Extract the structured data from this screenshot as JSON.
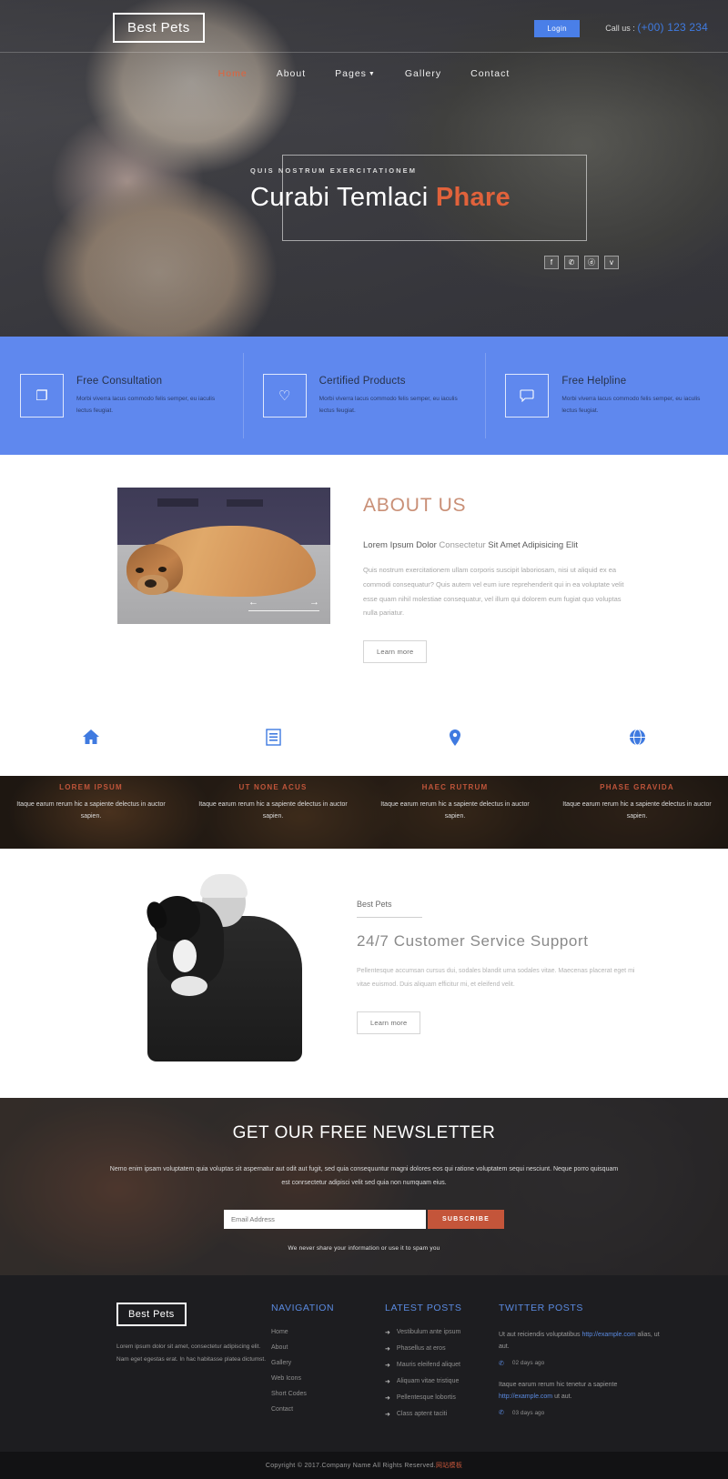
{
  "header": {
    "logo": "Best Pets",
    "login_label": "Login",
    "callus_label": "Call us :",
    "phone": "(+00) 123 234",
    "nav": [
      {
        "label": "Home",
        "active": true
      },
      {
        "label": "About",
        "active": false
      },
      {
        "label": "Pages",
        "active": false,
        "has_dropdown": true
      },
      {
        "label": "Gallery",
        "active": false
      },
      {
        "label": "Contact",
        "active": false
      }
    ]
  },
  "hero": {
    "eyebrow": "QUIS NOSTRUM EXERCITATIONEM",
    "title_plain": "Curabi Temlaci ",
    "title_highlight": "Phare",
    "socials": [
      {
        "name": "facebook-icon",
        "glyph": "f"
      },
      {
        "name": "twitter-icon",
        "glyph": "✆"
      },
      {
        "name": "dribbble-icon",
        "glyph": "ⓓ"
      },
      {
        "name": "vimeo-icon",
        "glyph": "v"
      }
    ]
  },
  "services": [
    {
      "icon": "copy-icon",
      "glyph": "❐",
      "title": "Free Consultation",
      "text": "Morbi viverra lacus commodo felis semper, eu iaculis lectus feugiat."
    },
    {
      "icon": "heart-icon",
      "glyph": "♡",
      "title": "Certified Products",
      "text": "Morbi viverra lacus commodo felis semper, eu iaculis lectus feugiat."
    },
    {
      "icon": "comment-icon",
      "glyph": "◯",
      "title": "Free Helpline",
      "text": "Morbi viverra lacus commodo felis semper, eu iaculis lectus feugiat."
    }
  ],
  "about": {
    "heading": "ABOUT US",
    "subtitle_1": "Lorem Ipsum Dolor ",
    "subtitle_grey": "Consectetur ",
    "subtitle_2": "Sit Amet Adipisicing Elit",
    "paragraph": "Quis nostrum exercitationem ullam corporis suscipit laboriosam, nisi ut aliquid ex ea commodi consequatur? Quis autem vel eum iure reprehenderit qui in ea voluptate velit esse quam nihil molestiae consequatur, vel illum qui dolorem eum fugiat quo voluptas nulla pariatur.",
    "button": "Learn more",
    "slider_prev": "←",
    "slider_next": "→"
  },
  "icon_row": [
    {
      "name": "home-icon",
      "glyph": "⌂"
    },
    {
      "name": "list-icon",
      "glyph": "☷"
    },
    {
      "name": "map-pin-icon",
      "glyph": "⚑"
    },
    {
      "name": "globe-icon",
      "glyph": "⊕"
    }
  ],
  "strip": [
    {
      "title": "LOREM IPSUM",
      "text": "Itaque earum rerum hic a sapiente delectus in auctor sapien."
    },
    {
      "title": "UT NONE ACUS",
      "text": "Itaque earum rerum hic a sapiente delectus in auctor sapien."
    },
    {
      "title": "HAEC RUTRUM",
      "text": "Itaque earum rerum hic a sapiente delectus in auctor sapien."
    },
    {
      "title": "PHASE GRAVIDA",
      "text": "Itaque earum rerum hic a sapiente delectus in auctor sapien."
    }
  ],
  "support": {
    "brand": "Best Pets",
    "heading": "24/7 Customer Service Support",
    "paragraph": "Pellentesque accumsan cursus dui, sodales blandit urna sodales vitae. Maecenas placerat eget mi vitae euismod. Duis aliquam efficitur mi, et eleifend velit.",
    "button": "Learn more"
  },
  "newsletter": {
    "heading": "GET OUR FREE NEWSLETTER",
    "paragraph": "Nemo enim ipsam voluptatem quia voluptas sit aspernatur aut odit aut fugit, sed quia consequuntur magni dolores eos qui ratione voluptatem sequi nesciunt. Neque porro quisquam est conrsectetur adipisci velit sed quia non numquam eius.",
    "placeholder": "Email Address",
    "button": "SUBSCRIBE",
    "note": "We never share your information or use it to spam you"
  },
  "footer": {
    "logo": "Best Pets",
    "description": "Lorem ipsum dolor sit amet, consectetur adipiscing elit. Nam eget egestas erat. In hac habitasse platea dictumst.",
    "navigation": {
      "heading": "NAVIGATION",
      "links": [
        "Home",
        "About",
        "Gallery",
        "Web Icons",
        "Short Codes",
        "Contact"
      ]
    },
    "latest_posts": {
      "heading": "LATEST POSTS",
      "arrow": "➜",
      "items": [
        "Vestibulum ante ipsum",
        "Phasellus at eros",
        "Mauris eleifend aliquet",
        "Aliquam vitae tristique",
        "Pellentesque lobortis",
        "Class aptent taciti"
      ]
    },
    "twitter_posts": {
      "heading": "TWITTER POSTS",
      "bird": "✆",
      "items": [
        {
          "text_before": "Ut aut reiciendis voluptatibus ",
          "link": "http://example.com",
          "text_after": " alias, ut aut.",
          "time": "02 days ago"
        },
        {
          "text_before": "Itaque earum rerum hic tenetur a sapiente ",
          "link": "http://example.com",
          "text_after": " ut aut.",
          "time": "03 days ago"
        }
      ]
    },
    "copyright_text": "Copyright © 2017.Company Name All Rights Reserved.",
    "copyright_cn": "网站模板"
  },
  "colors": {
    "accent_orange": "#e1623b",
    "brand_blue": "#5f88ee",
    "link_blue": "#3f7ae0",
    "subscribe_red": "#c4553a"
  }
}
